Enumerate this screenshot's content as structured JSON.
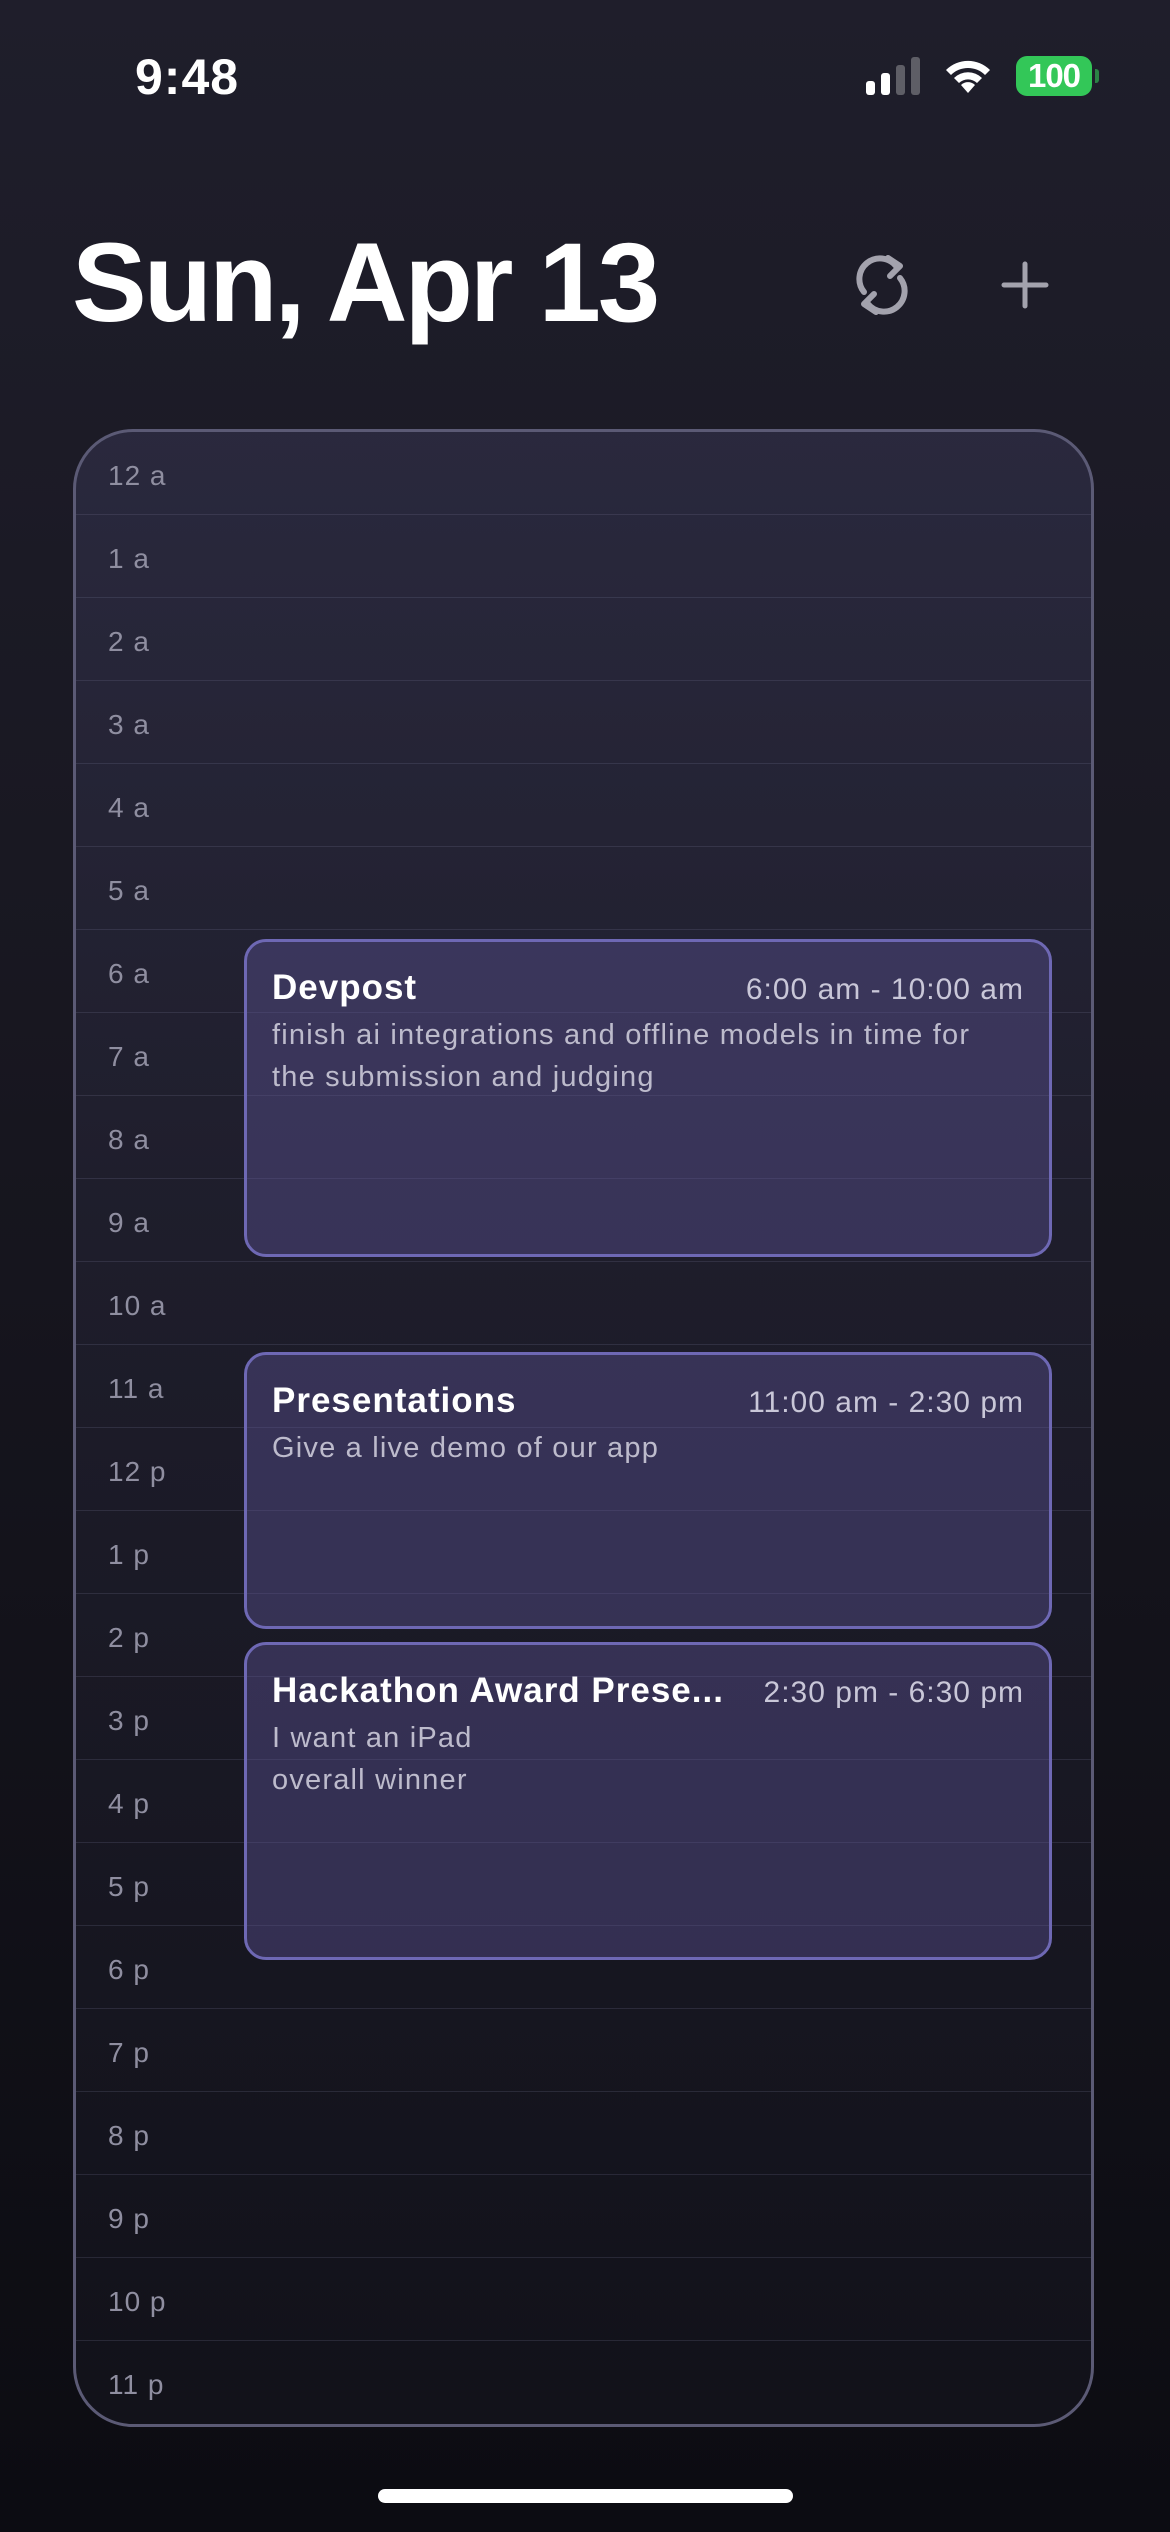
{
  "status_bar": {
    "time": "9:48",
    "battery": "100"
  },
  "header": {
    "title": "Sun, Apr 13",
    "refresh_icon": "refresh-icon",
    "add_icon": "plus-icon"
  },
  "hours": [
    "12 a",
    "1 a",
    "2 a",
    "3 a",
    "4 a",
    "5 a",
    "6 a",
    "7 a",
    "8 a",
    "9 a",
    "10 a",
    "11 a",
    "12 p",
    "1 p",
    "2 p",
    "3 p",
    "4 p",
    "5 p",
    "6 p",
    "7 p",
    "8 p",
    "9 p",
    "10 p",
    "11 p"
  ],
  "events": [
    {
      "title": "Devpost",
      "time": "6:00 am - 10:00 am",
      "description": [
        "finish ai integrations and offline models in time for",
        "the submission and judging"
      ]
    },
    {
      "title": "Presentations",
      "time": "11:00 am - 2:30 pm",
      "description": [
        "Give a live demo of our app"
      ]
    },
    {
      "title": "Hackathon Award Prese...",
      "time": "2:30 pm - 6:30 pm",
      "description": [
        "I want an iPad",
        "overall winner"
      ]
    }
  ],
  "colors": {
    "accent": "#6e68b4",
    "battery": "#33c758",
    "background": "#17161f"
  }
}
